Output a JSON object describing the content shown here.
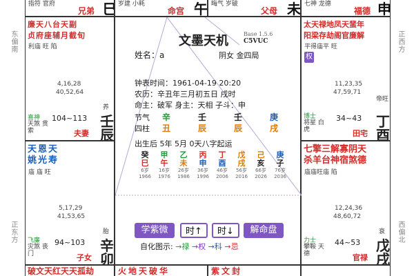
{
  "outer": {
    "left_top": "东偏南",
    "left_bottom": "正东方",
    "right_top": "正西方",
    "right_bottom": "西偏北"
  },
  "top_strip": [
    {
      "stars": "指符 官府",
      "palace": "兄弟",
      "gz": "巳"
    },
    {
      "stars": "岁建 小耗",
      "palace": "命宫",
      "gz": "午"
    },
    {
      "stars": "晦气 岁破",
      "palace": "父母",
      "gz": "未"
    },
    {
      "stars": "七神 龙德",
      "palace": "福德",
      "gz": "申"
    }
  ],
  "cell_tl": {
    "stars_row1": "廉天八台天副",
    "stars_row2": "贞府座辅月截旬",
    "brightness": "利庙  旺  陷",
    "ages1": "4,16,28",
    "ages2": "40,52,64",
    "god": "喜神",
    "extras": "天煞 贯索",
    "range": "104~113",
    "palace": "夫妻",
    "gan": "壬",
    "zhi": "辰",
    "phase": "养"
  },
  "cell_tr": {
    "stars_row1": "太天禄地凤天蜚年",
    "stars_row2": "阳梁存劫阁官廉解",
    "brightness": "平得庙平  旺",
    "sihua": "权",
    "ages1": "11,23,35",
    "ages2": "47,59,71",
    "god": "博士",
    "extras": "将星 白虎",
    "range": "34~43",
    "palace": "田宅",
    "gan": "丁",
    "zhi": "酉",
    "phase": "帝旺"
  },
  "cell_ml": {
    "stars_row1": "天恩天",
    "stars_row2": "姚光寿",
    "brightness": "庙 庙 旺"
  },
  "cell_mr": {
    "stars_row1": "七擎三解寡阴天",
    "stars_row2": "杀羊台神宿煞德",
    "brightness": "庙庙旺庙 陷"
  },
  "cell_bl": {
    "ages1": "5,17,29",
    "ages2": "41,53,65",
    "god": "飞廉",
    "extras": "灾煞 丧门",
    "range": "94~103",
    "palace": "子女",
    "gan": "辛",
    "zhi": "卯",
    "phase": "胎"
  },
  "cell_br": {
    "ages1": "12,24,36",
    "ages2": "48,60,72",
    "god": "力士",
    "extras": "攀鞍 天德",
    "range": "44~53",
    "palace": "官禄",
    "gan": "戊",
    "zhi": "戌",
    "phase": "衰"
  },
  "bottom_strip": [
    {
      "stars": "破文天红天天孤劫"
    },
    {
      "stars": "火地天破华"
    },
    {
      "stars": "紫文封"
    }
  ],
  "center": {
    "title": "文墨天机",
    "version": "Base 1.5.6",
    "sub": "C5VUC",
    "name_label": "姓名：a",
    "gender": "阴女 金四局",
    "clock": "钟表时间：1961-04-19 20:20",
    "lunar": "农历：辛丑年三月初五日 戌时",
    "master": "命主：破军 身主：天相 子斗：申",
    "jieqi_label": "节气",
    "sizhu_label": "四柱",
    "pillars_top": [
      "辛",
      "壬",
      "壬",
      "庚"
    ],
    "pillars_bot": [
      "丑",
      "辰",
      "辰",
      "戌"
    ],
    "qiyun": "出生后 5年 5月 0天八字起运",
    "dayun_gan": [
      "癸",
      "甲",
      "乙",
      "丙",
      "丁",
      "戊",
      "己",
      "庚"
    ],
    "dayun_zhi": [
      "巳",
      "午",
      "未",
      "申",
      "酉",
      "戌",
      "亥",
      "子"
    ],
    "dayun_age": [
      "6岁",
      "16岁",
      "26岁",
      "36岁",
      "46岁",
      "56岁",
      "66岁",
      "76岁"
    ],
    "dayun_year": [
      "1966",
      "1976",
      "1986",
      "1996",
      "2006",
      "2016",
      "2026",
      "2036"
    ],
    "buttons": {
      "learn": "学紫微",
      "time_up": "时↑",
      "time_down": "时↓",
      "interpret": "解命盘"
    },
    "legend_label": "自化图示:",
    "legend": [
      "→禄",
      "→权",
      "→科",
      "→忌"
    ]
  },
  "colors": {
    "purple": "#7e57c2",
    "red": "#d62b2b",
    "blue": "#1f5fb8",
    "green": "#1e9a3a",
    "orange": "#e07a00"
  }
}
